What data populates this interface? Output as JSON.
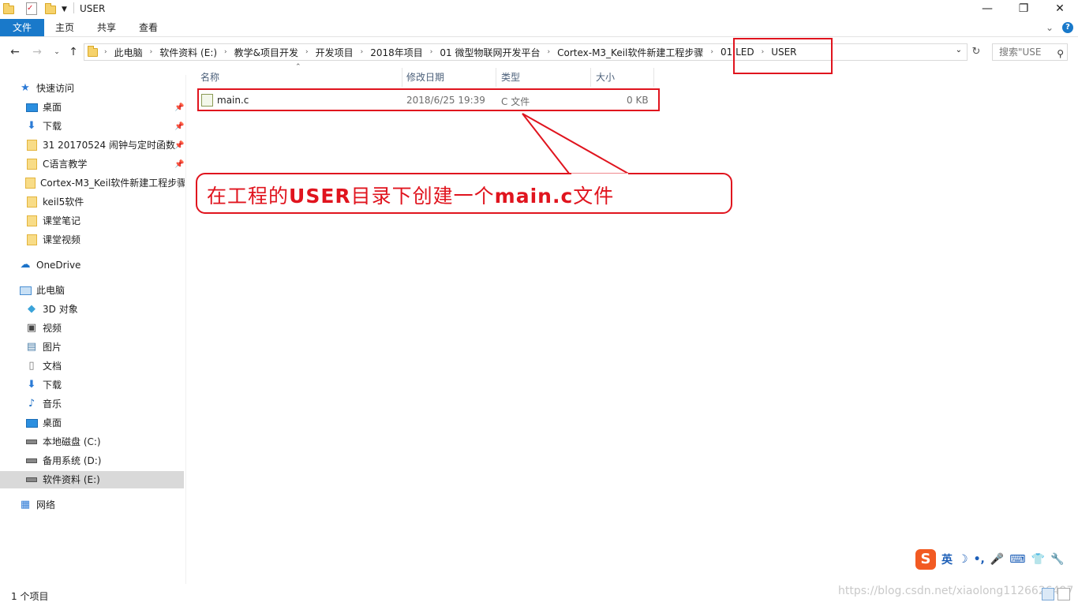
{
  "window": {
    "title": "USER",
    "minimize": "—",
    "maximize": "❐",
    "close": "✕"
  },
  "ribbon": {
    "tabs": [
      "文件",
      "主页",
      "共享",
      "查看"
    ],
    "expand_glyph": "⌄",
    "help_glyph": "?"
  },
  "address": {
    "breadcrumbs": [
      "此电脑",
      "软件资料 (E:)",
      "教学&项目开发",
      "开发项目",
      "2018年项目",
      "01 微型物联网开发平台",
      "Cortex-M3_Keil软件新建工程步骤",
      "01 LED",
      "USER"
    ],
    "separator": "›",
    "search_placeholder": "搜索\"USE"
  },
  "sidebar": {
    "quick_access": {
      "label": "快速访问",
      "items": [
        {
          "label": "桌面",
          "icon": "desktop-icon",
          "pinned": true
        },
        {
          "label": "下载",
          "icon": "download-icon",
          "pinned": true
        },
        {
          "label": "31 20170524  闹钟与定时函数",
          "icon": "folder-icon",
          "pinned": true
        },
        {
          "label": "C语言教学",
          "icon": "folder-icon",
          "pinned": true
        },
        {
          "label": "Cortex-M3_Keil软件新建工程步骤",
          "icon": "folder-icon",
          "pinned": false
        },
        {
          "label": "keil5软件",
          "icon": "folder-icon",
          "pinned": false
        },
        {
          "label": "课堂笔记",
          "icon": "folder-icon",
          "pinned": false
        },
        {
          "label": "课堂视频",
          "icon": "folder-icon",
          "pinned": false
        }
      ]
    },
    "onedrive": "OneDrive",
    "this_pc": {
      "label": "此电脑",
      "items": [
        {
          "label": "3D 对象",
          "icon": "cube-icon"
        },
        {
          "label": "视频",
          "icon": "video-icon"
        },
        {
          "label": "图片",
          "icon": "picture-icon"
        },
        {
          "label": "文档",
          "icon": "document-icon"
        },
        {
          "label": "下载",
          "icon": "download-icon"
        },
        {
          "label": "音乐",
          "icon": "music-icon"
        },
        {
          "label": "桌面",
          "icon": "desktop-icon"
        },
        {
          "label": "本地磁盘 (C:)",
          "icon": "drive-icon"
        },
        {
          "label": "备用系统 (D:)",
          "icon": "drive-icon"
        },
        {
          "label": "软件资料 (E:)",
          "icon": "drive-icon",
          "selected": true
        }
      ]
    },
    "network": "网络"
  },
  "file_list": {
    "columns": [
      "名称",
      "修改日期",
      "类型",
      "大小"
    ],
    "rows": [
      {
        "name": "main.c",
        "modified": "2018/6/25 19:39",
        "type": "C 文件",
        "size": "0 KB"
      }
    ]
  },
  "callout": {
    "parts": [
      "在工程的",
      "USER",
      "目录下创建一个",
      "main.c",
      "文件"
    ]
  },
  "status": {
    "item_count": "1 个项目"
  },
  "ime": {
    "logo": "S",
    "lang": "英",
    "items": [
      "☽",
      "•,",
      "🎤",
      "⌨",
      "👕",
      "🔧"
    ]
  },
  "watermark": "https://blog.csdn.net/xiaolong1126626497"
}
